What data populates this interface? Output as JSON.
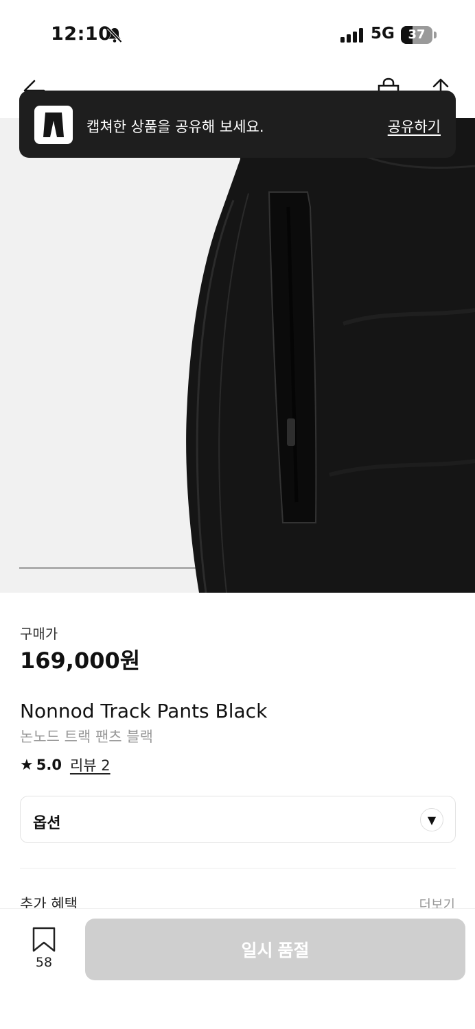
{
  "status_bar": {
    "time": "12:10",
    "network": "5G",
    "battery": "37",
    "battery_level": 0.37,
    "icons": [
      "bell-slash-icon",
      "signal-icon",
      "battery-icon"
    ]
  },
  "nav": {
    "icons": [
      "back-arrow-icon",
      "shopping-bag-icon",
      "share-icon"
    ]
  },
  "toast": {
    "message": "캡쳐한 상품을 공유해 보세요.",
    "action": "공유하기"
  },
  "product": {
    "price_label": "구매가",
    "price": "169,000원",
    "title_en": "Nonnod Track Pants Black",
    "title_ko": "논노드 트랙 팬츠 블랙",
    "rating": "5.0",
    "review_label": "리뷰 2"
  },
  "option": {
    "label": "옵션"
  },
  "benefits": {
    "label": "추가 혜택",
    "more": "더보기"
  },
  "bottom_bar": {
    "wishlist_count": "58",
    "button_label": "일시 품절"
  }
}
